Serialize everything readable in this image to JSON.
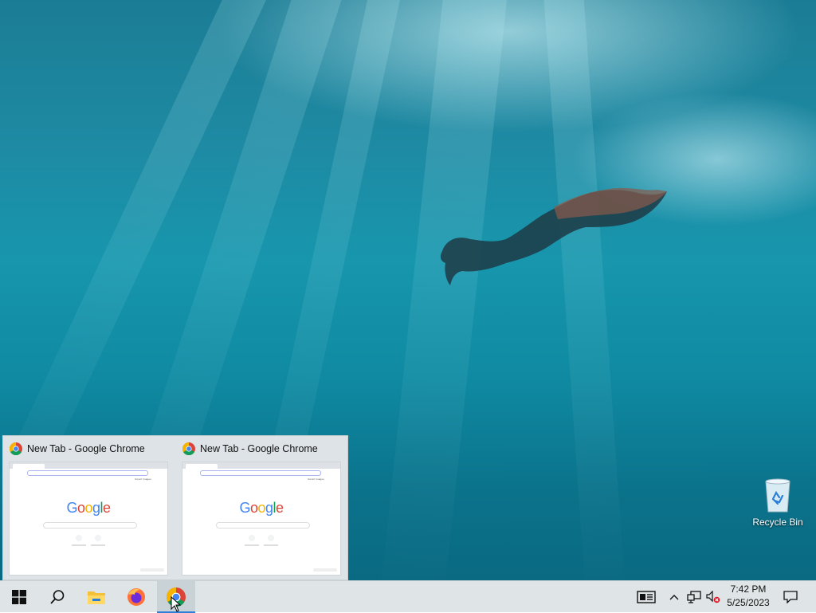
{
  "desktop": {
    "icons": [
      {
        "label": "Recycle Bin",
        "icon": "recycle-bin-icon"
      }
    ]
  },
  "thumbnail_previews": [
    {
      "title": "New Tab - Google Chrome",
      "icon": "chrome-icon",
      "content": {
        "logo_text": "Google"
      }
    },
    {
      "title": "New Tab - Google Chrome",
      "icon": "chrome-icon",
      "content": {
        "logo_text": "Google"
      }
    }
  ],
  "taskbar": {
    "buttons": [
      {
        "icon": "windows-start-icon"
      },
      {
        "icon": "search-icon"
      },
      {
        "icon": "file-explorer-icon"
      },
      {
        "icon": "firefox-icon"
      },
      {
        "icon": "chrome-icon",
        "active": true
      }
    ],
    "tray": [
      {
        "icon": "news-and-interests-icon"
      },
      {
        "icon": "chevron-up-icon"
      },
      {
        "icon": "network-icon"
      },
      {
        "icon": "volume-muted-icon"
      }
    ],
    "clock": {
      "time": "7:42 PM",
      "date": "5/25/2023"
    },
    "notifications_icon": "action-center-icon"
  },
  "colors": {
    "taskbar_bg": "#dfe5e7",
    "active_indicator": "#2f7ed8",
    "water_deep": "#0a6a82",
    "water_light": "#1e8aa3"
  }
}
